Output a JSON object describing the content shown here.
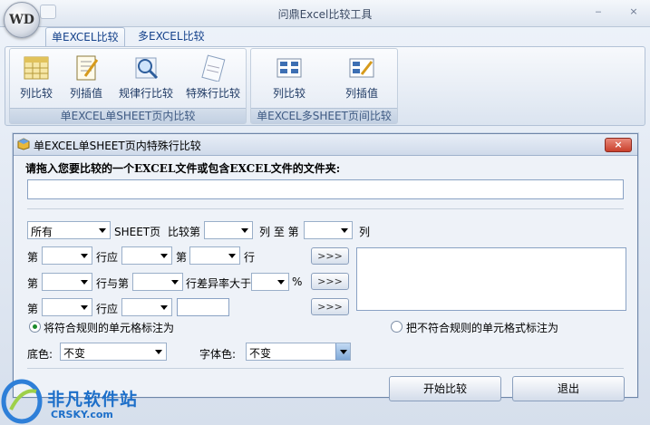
{
  "app": {
    "title": "问鼎Excel比较工具",
    "logo_text": "WD"
  },
  "window_controls": {
    "minimize": "‒",
    "close": "×"
  },
  "tabs": [
    {
      "label": "单EXCEL比较",
      "active": true
    },
    {
      "label": "多EXCEL比较",
      "active": false
    }
  ],
  "ribbon": {
    "group1": {
      "label": "单EXCEL单SHEET页内比较",
      "buttons": [
        {
          "label": "列比较",
          "icon": "column-compare-icon"
        },
        {
          "label": "列插值",
          "icon": "column-interpolate-icon"
        },
        {
          "label": "规律行比较",
          "icon": "pattern-row-search-icon"
        },
        {
          "label": "特殊行比较",
          "icon": "special-row-icon"
        }
      ]
    },
    "group2": {
      "label": "单EXCEL多SHEET页间比较",
      "buttons": [
        {
          "label": "列比较",
          "icon": "multi-column-compare-icon"
        },
        {
          "label": "列插值",
          "icon": "multi-column-interpolate-icon"
        }
      ]
    }
  },
  "dialog": {
    "title": "单EXCEL单SHEET页内特殊行比较",
    "close_label": "×",
    "drop_prompt": "请拖入您要比较的一个EXCEL文件或包含EXCEL文件的文件夹:",
    "file_path": "",
    "row1": {
      "sheet_select": "所有",
      "sheet_label": "SHEET页",
      "compare_col_label": "比较第",
      "col_from": "",
      "to_label": "列 至 第",
      "col_to": "",
      "col_suffix": "列"
    },
    "row2": {
      "prefix": "第",
      "select_a": "",
      "row_should": "行应",
      "select_b": "",
      "di": "第",
      "select_c": "",
      "row": "行",
      "more": ">>>"
    },
    "row3": {
      "prefix": "第",
      "select_a": "",
      "row_and": "行与第",
      "select_b": "",
      "diff_rate": "行差异率大于",
      "select_c": "",
      "percent": "%",
      "more": ">>>"
    },
    "row4": {
      "prefix": "第",
      "select_a": "",
      "row_should": "行应",
      "select_b": "",
      "value": "",
      "more": ">>>"
    },
    "radio_match": "将符合规则的单元格标注为",
    "radio_nonmatch": "把不符合规则的单元格式标注为",
    "bg_label": "底色:",
    "bg_value": "不变",
    "font_color_label": "字体色:",
    "font_color_value": "不变",
    "start_button": "开始比较",
    "exit_button": "退出"
  },
  "watermark": {
    "text": "非凡软件站",
    "sub": "CRSKY.com"
  }
}
